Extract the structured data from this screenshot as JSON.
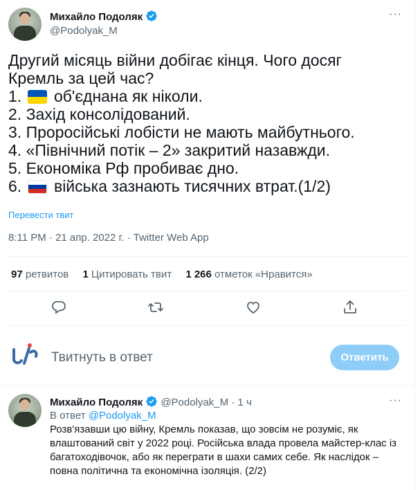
{
  "tweet": {
    "author_name": "Михайло Подоляк",
    "author_handle": "@Podolyak_M",
    "lines": [
      "Другий місяць війни добігає кінця. Чого досяг",
      "Кремль за цей час?",
      "1. ",
      "2. Захід консолідований.",
      "3. Проросійські лобісти не мають майбутнього.",
      "4. «Північний потік – 2» закритий назавжди.",
      "5. Економіка Рф пробиває дно.",
      "6. "
    ],
    "line3_rest": "об'єднана як ніколи.",
    "line8_rest": "війська зазнають тисячних втрат.(1/2)",
    "translate_label": "Перевести твит",
    "timestamp": "8:11 PM · 21 апр. 2022 г. · Twitter Web App",
    "stats": {
      "retweets_count": "97",
      "retweets_label": "ретвитов",
      "quotes_count": "1",
      "quotes_label": "Цитировать твит",
      "likes_count": "1 266",
      "likes_label": "отметок «Нравится»"
    },
    "actions": [
      "reply-icon",
      "retweet-icon",
      "like-icon",
      "share-icon"
    ]
  },
  "reply_composer": {
    "placeholder": "Твитнуть в ответ",
    "button_label": "Ответить"
  },
  "reply_tweet": {
    "author_name": "Михайло Подоляк",
    "author_handle": "@Podolyak_M",
    "time": "· 1 ч",
    "in_reply_prefix": "В ответ",
    "in_reply_handle": "@Podolyak_M",
    "text": "Розв'язавши цю війну, Кремль показав, що зовсім не розуміє, як влаштований світ у 2022 році. Російська влада провела майстер-клас із багатоходівочок, або як переграти в шахи самих себе. Як наслідок – повна політична та економічна ізоляція. (2/2)"
  },
  "colors": {
    "accent": "#1d9bf0",
    "reply_button": "#8ecdf7",
    "muted": "#536471",
    "flag_ua_blue": "#0057b7",
    "flag_ua_yellow": "#ffd700",
    "flag_ru_white": "#ffffff",
    "flag_ru_blue": "#0039a6",
    "flag_ru_red": "#d52b1e"
  }
}
